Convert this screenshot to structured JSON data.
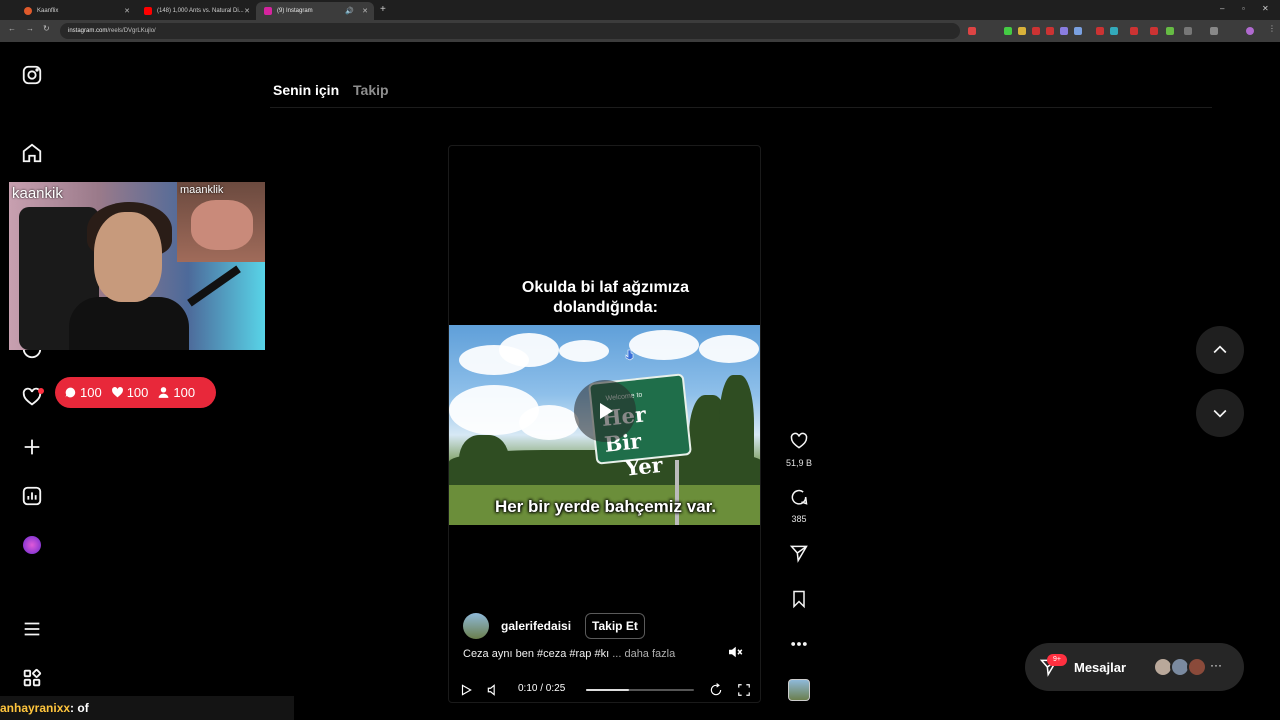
{
  "browser": {
    "tabs": [
      {
        "title": "Kaanflix",
        "favicon_color": "#e05a2b",
        "active": false
      },
      {
        "title": "(148) 1,000 Ants vs. Natural Di...",
        "favicon_color": "#ff0000",
        "active": false
      },
      {
        "title": "(9) Instagram",
        "favicon_color": "#d6249f",
        "active": true
      }
    ],
    "new_tab_glyph": "+",
    "url_host": "instagram.com",
    "url_path": "/reels/DVgrLKujlo/"
  },
  "sidebar": {
    "items": [
      {
        "name": "instagram-logo-icon"
      },
      {
        "name": "home-icon"
      },
      {
        "name": "explore-icon"
      },
      {
        "name": "notifications-icon"
      },
      {
        "name": "create-icon"
      },
      {
        "name": "dashboard-icon"
      },
      {
        "name": "profile-avatar"
      },
      {
        "name": "more-menu-icon"
      },
      {
        "name": "also-from-meta-icon"
      }
    ]
  },
  "feed_tabs": {
    "for_you": "Senin için",
    "following": "Takip"
  },
  "reel": {
    "caption_top_line1": "Okulda bi laf ağzımıza",
    "caption_top_line2": "dolandığında:",
    "sign_welcome": "Welcome to",
    "sign_line1": "Her Bir",
    "sign_line2": "Yer",
    "subtitle": "Her bir yerde bahçemiz var.",
    "author": "galerifedaisi",
    "follow_label": "Takip Et",
    "description": "Ceza aynı ben #ceza #rap #kı",
    "description_more_prefix": "...",
    "description_more": "daha fazla",
    "time": "0:10 / 0:25",
    "progress": 0.4
  },
  "actions": {
    "likes": "51,9 B",
    "comments": "385"
  },
  "messages": {
    "label": "Mesajlar",
    "badge": "9+"
  },
  "overlay": {
    "streamer_name": "kaankik",
    "guest_name": "maanklik",
    "stats": {
      "comments": "100",
      "likes": "100",
      "followers": "100"
    },
    "chat_user": "anhayranixx",
    "chat_message": ": of"
  },
  "colors": {
    "background": "#000000",
    "accent_red": "#ff3040",
    "stats_red": "#e8283a",
    "chat_user": "#ffc53d"
  }
}
